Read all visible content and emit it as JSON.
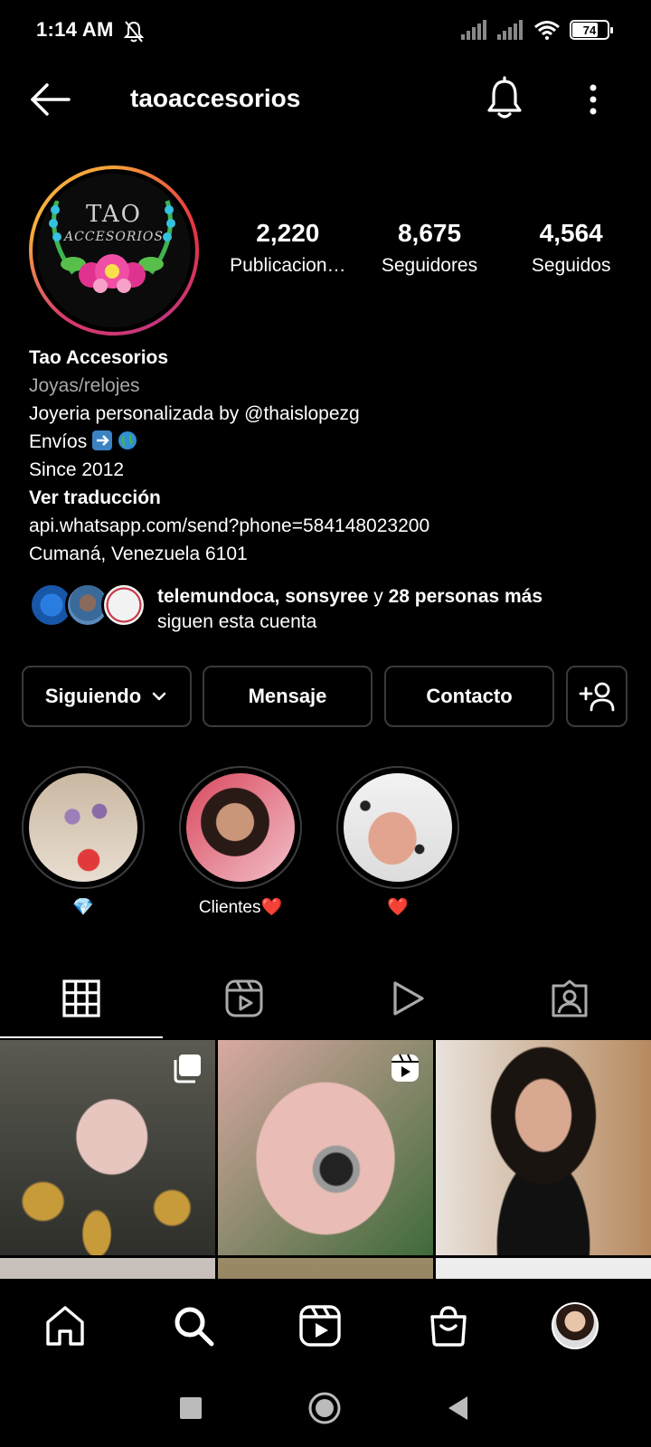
{
  "status_bar": {
    "time": "1:14 AM",
    "battery": 74,
    "battery_text": "74"
  },
  "header": {
    "username": "taoaccesorios"
  },
  "profile": {
    "avatar_text": "TAO",
    "avatar_subtext": "ACCESORIOS",
    "stats": [
      {
        "value": "2,220",
        "label": "Publicacion…"
      },
      {
        "value": "8,675",
        "label": "Seguidores"
      },
      {
        "value": "4,564",
        "label": "Seguidos"
      }
    ]
  },
  "bio": {
    "name": "Tao Accesorios",
    "category": "Joyas/relojes",
    "line1": "Joyeria personalizada  by @thaislopezg",
    "line2": "Envíos",
    "line3": "Since 2012",
    "translate": "Ver traducción",
    "link": "api.whatsapp.com/send?phone=584148023200",
    "location": "Cumaná, Venezuela 6101"
  },
  "followed_by": {
    "names": "telemundoca, sonsyree",
    "connector": "y",
    "others": "28 personas más",
    "line2": "siguen esta cuenta"
  },
  "actions": {
    "following": "Siguiendo",
    "message": "Mensaje",
    "contact": "Contacto"
  },
  "highlights": [
    {
      "label": "💎"
    },
    {
      "label": "Clientes❤️"
    },
    {
      "label": "❤️"
    }
  ],
  "colors": {
    "background": "#000000",
    "text": "#ffffff",
    "muted": "#a8a8a8",
    "border": "#3a3a3a"
  }
}
